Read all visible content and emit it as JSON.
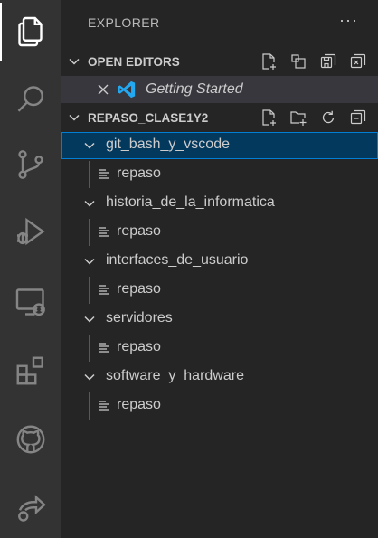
{
  "explorer": {
    "title": "EXPLORER",
    "more": "···"
  },
  "open_editors": {
    "title": "OPEN EDITORS",
    "items": [
      {
        "label": "Getting Started"
      }
    ]
  },
  "workspace": {
    "title": "REPASO_CLASE1Y2",
    "folders": [
      {
        "name": "git_bash_y_vscode",
        "file": "repaso"
      },
      {
        "name": "historia_de_la_informatica",
        "file": "repaso"
      },
      {
        "name": "interfaces_de_usuario",
        "file": "repaso"
      },
      {
        "name": "servidores",
        "file": "repaso"
      },
      {
        "name": "software_y_hardware",
        "file": "repaso"
      }
    ]
  },
  "colors": {
    "activity_bar": "#333333",
    "sidebar": "#252526",
    "selection": "#04395e",
    "selection_border": "#007fd4",
    "vscode_blue": "#23a9f2"
  }
}
